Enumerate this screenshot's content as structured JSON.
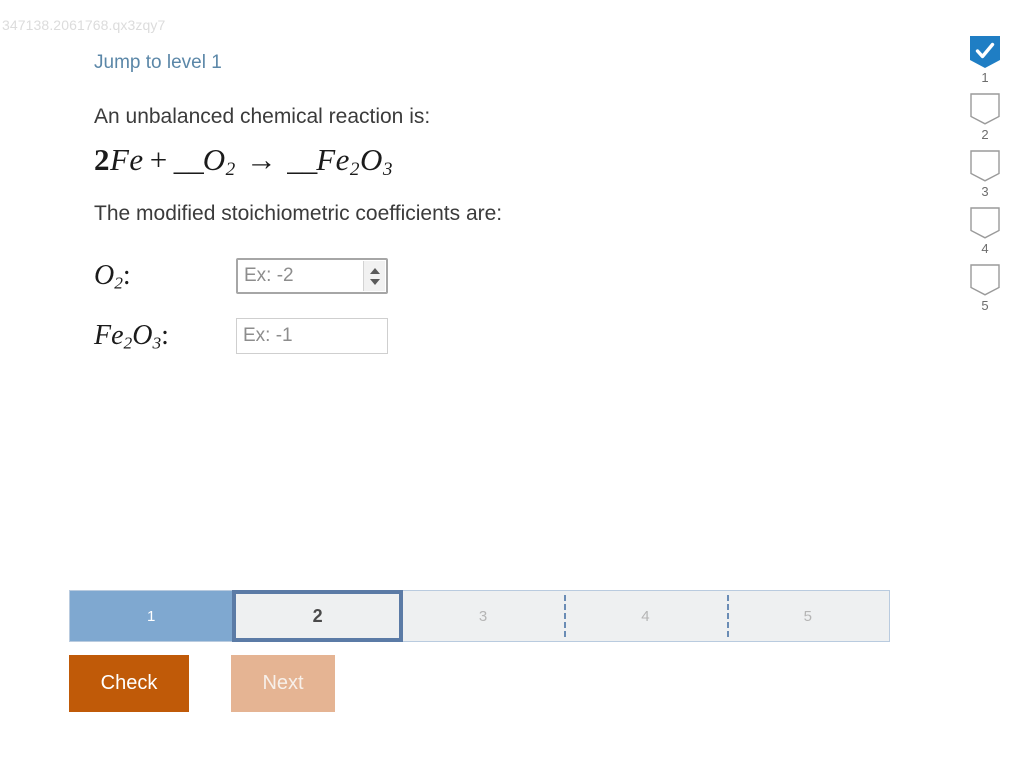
{
  "activity_id": "347138.2061768.qx3zqy7",
  "jump_link": {
    "label": "Jump to level 1"
  },
  "question": {
    "intro": "An unbalanced chemical reaction is:",
    "equation": {
      "coefficient_fe": "2",
      "reactant_fe": "Fe",
      "plus": "+",
      "blank_o2": "__",
      "reactant_o2": "O",
      "reactant_o2_sub": "2",
      "arrow": "→",
      "blank_fe2o3": "__",
      "product_fe": "Fe",
      "product_fe_sub": "2",
      "product_o": "O",
      "product_o_sub": "3",
      "plain_text": "2Fe + __O2 -> __Fe2O3"
    },
    "coefficients_prompt": "The modified stoichiometric coefficients are:"
  },
  "answers": [
    {
      "label_element": "O",
      "label_sub": "2",
      "label_colon": ":",
      "value": "",
      "placeholder": "Ex: -2",
      "focused": true,
      "has_spinner": true
    },
    {
      "label_element": "Fe",
      "label_sub": "2",
      "label_element2": "O",
      "label_sub2": "3",
      "label_colon": ":",
      "value": "",
      "placeholder": "Ex: -1",
      "focused": false,
      "has_spinner": false
    }
  ],
  "badges": [
    {
      "number": "1",
      "state": "completed",
      "icon": "check-icon"
    },
    {
      "number": "2",
      "state": "empty",
      "icon": ""
    },
    {
      "number": "3",
      "state": "empty",
      "icon": ""
    },
    {
      "number": "4",
      "state": "empty",
      "icon": ""
    },
    {
      "number": "5",
      "state": "empty",
      "icon": ""
    }
  ],
  "progress": {
    "segments": [
      {
        "label": "1",
        "state": "done"
      },
      {
        "label": "2",
        "state": "current"
      },
      {
        "label": "3",
        "state": "todo"
      },
      {
        "label": "4",
        "state": "todo"
      },
      {
        "label": "5",
        "state": "todo"
      }
    ]
  },
  "buttons": {
    "check": "Check",
    "next": "Next"
  },
  "colors": {
    "link": "#5b87a8",
    "badge_completed": "#1f7ec4",
    "progress_done": "#7fa8d0",
    "progress_current_border": "#5b7ba6",
    "progress_track": "#eef0f1",
    "check_button": "#c05a08",
    "next_button_disabled": "#e5b493"
  }
}
